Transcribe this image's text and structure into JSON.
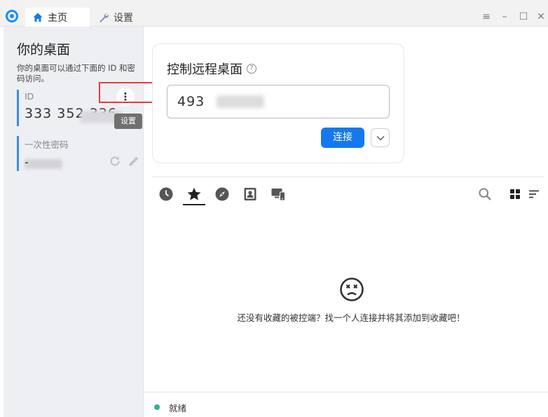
{
  "titlebar": {
    "tabs": [
      {
        "label": "主页",
        "icon": "home-icon"
      },
      {
        "label": "设置",
        "icon": "wrench-icon"
      }
    ],
    "window_controls": [
      "menu-icon",
      "minimize-icon",
      "maximize-icon",
      "close-icon"
    ]
  },
  "sidebar": {
    "title": "你的桌面",
    "description": "你的桌面可以通过下面的 ID 和密码访问。",
    "id_label": "ID",
    "id_value": "333 352 336",
    "menu_glyph": "⋮",
    "tooltip": "设置",
    "password_label": "一次性密码",
    "password_value": "-"
  },
  "control": {
    "title": "控制远程桌面",
    "help_glyph": "?",
    "input_value": "493",
    "connect_label": "连接"
  },
  "list_tabs": [
    "history-icon",
    "favorites-star-icon",
    "discovered-compass-icon",
    "address-book-icon",
    "lan-devices-icon"
  ],
  "list_toolbar": [
    "search-icon",
    "grid-view-icon",
    "sort-icon"
  ],
  "empty_state": {
    "message": "还没有收藏的被控端？找一个人连接并将其添加到收藏吧！"
  },
  "status": {
    "text": "就绪",
    "color": "#27b68f"
  },
  "colors": {
    "accent": "#1479ef",
    "highlight_box": "#e83b3b"
  }
}
